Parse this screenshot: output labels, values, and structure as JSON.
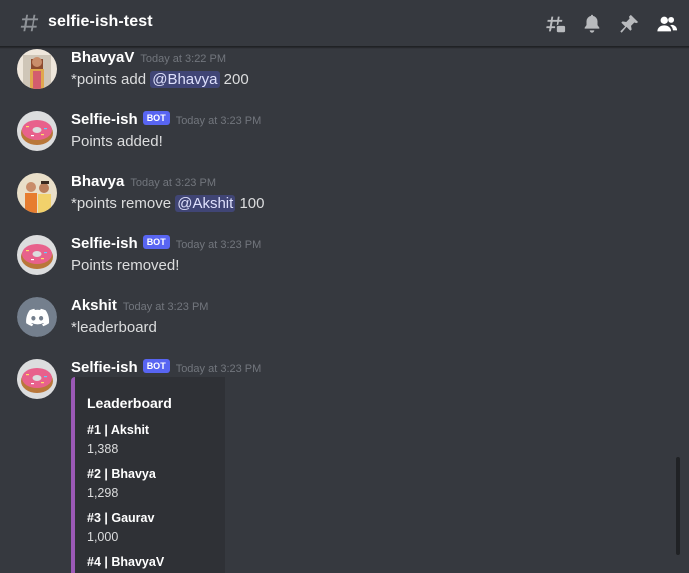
{
  "header": {
    "channel": "selfie-ish-test",
    "icons": [
      "hashtag-icon",
      "threads-icon",
      "bell-icon",
      "pin-icon",
      "members-icon"
    ]
  },
  "messages": [
    {
      "author": "BhavyaV",
      "bot": false,
      "timestamp": "Today at 3:22 PM",
      "before": "*points add ",
      "mention": "@Bhavya",
      "after": " 200",
      "avatar": "photo"
    },
    {
      "author": "Selfie-ish",
      "bot": true,
      "bot_label": "BOT",
      "timestamp": "Today at 3:23 PM",
      "text": "Points added!",
      "avatar": "donut"
    },
    {
      "author": "Bhavya",
      "bot": false,
      "timestamp": "Today at 3:23 PM",
      "before": "*points remove ",
      "mention": "@Akshit",
      "after": " 100",
      "avatar": "photo"
    },
    {
      "author": "Selfie-ish",
      "bot": true,
      "bot_label": "BOT",
      "timestamp": "Today at 3:23 PM",
      "text": "Points removed!",
      "avatar": "donut"
    },
    {
      "author": "Akshit",
      "bot": false,
      "timestamp": "Today at 3:23 PM",
      "text": "*leaderboard",
      "avatar": "discord-default"
    },
    {
      "author": "Selfie-ish",
      "bot": true,
      "bot_label": "BOT",
      "timestamp": "Today at 3:23 PM",
      "avatar": "donut"
    }
  ],
  "embed": {
    "title": "Leaderboard",
    "accent_color": "#9b59b6",
    "fields": [
      {
        "name": "#1 | Akshit",
        "value": "1,388"
      },
      {
        "name": "#2 | Bhavya",
        "value": "1,298"
      },
      {
        "name": "#3 | Gaurav",
        "value": "1,000"
      },
      {
        "name": "#4 | BhavyaV",
        "value": ""
      }
    ]
  },
  "colors": {
    "background": "#36393f",
    "embed_bg": "#2f3136",
    "bot_tag": "#5865f2",
    "mention_bg": "#414675",
    "timestamp": "#72767d"
  }
}
